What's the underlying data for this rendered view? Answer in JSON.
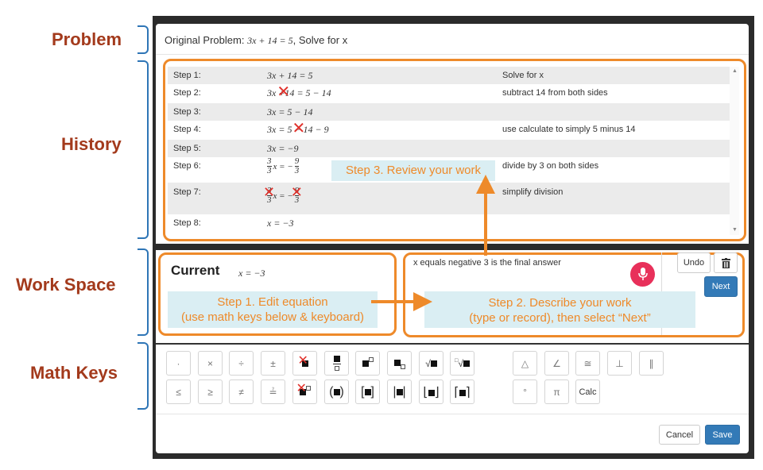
{
  "labels": {
    "problem": "Problem",
    "history": "History",
    "work_space": "Work Space",
    "math_keys": "Math Keys"
  },
  "original_problem": {
    "prefix": "Original Problem:",
    "equation": "3x + 14 = 5",
    "suffix": ", Solve for x"
  },
  "history": [
    {
      "step": "Step 1:",
      "eq_a": "3x + 14 = 5",
      "eq_b": "",
      "eq_c": "",
      "desc": "Solve for x"
    },
    {
      "step": "Step 2:",
      "eq_a": "3x",
      "eq_b": "+14",
      "eq_c": "= 5 − 14",
      "desc": "subtract 14 from both sides"
    },
    {
      "step": "Step 3:",
      "eq_a": "3x = 5 − 14",
      "eq_b": "",
      "eq_c": "",
      "desc": ""
    },
    {
      "step": "Step 4:",
      "eq_a": "3x =",
      "eq_b": "5 − 14",
      "eq_c": "− 9",
      "desc": "use calculate to simply 5 minus 14"
    },
    {
      "step": "Step 5:",
      "eq_a": "3x = −9",
      "eq_b": "",
      "eq_c": "",
      "desc": ""
    },
    {
      "step": "Step 6:",
      "eq_a": "x = −",
      "eq_b": "",
      "eq_c": "",
      "desc": "divide by 3 on both sides"
    },
    {
      "step": "Step 7:",
      "eq_a": "x = −",
      "eq_b": "",
      "eq_c": "",
      "desc": "simplify division"
    },
    {
      "step": "Step 8:",
      "eq_a": "x = −3",
      "eq_b": "",
      "eq_c": "",
      "desc": ""
    }
  ],
  "fractions": {
    "three": "3",
    "nine": "9"
  },
  "current": {
    "label": "Current",
    "equation": "x = −3"
  },
  "description_text": "x equals negative 3 is the final answer",
  "buttons": {
    "undo": "Undo",
    "next": "Next",
    "cancel": "Cancel",
    "save": "Save",
    "calc": "Calc"
  },
  "callouts": {
    "step1_line1": "Step 1. Edit equation",
    "step1_line2": "(use math keys below & keyboard)",
    "step2_line1": "Step 2. Describe your work",
    "step2_line2": "(type or record), then select “Next”",
    "step3": "Step 3. Review your work"
  },
  "keys_row1": [
    "·",
    "×",
    "÷",
    "±"
  ],
  "keys_row2": [
    "≤",
    "≥",
    "≠",
    "≟"
  ],
  "geo_row1": [
    "△",
    "∠",
    "≅",
    "⊥",
    "∥"
  ],
  "geo_row2": [
    "°",
    "π"
  ],
  "colors": {
    "accent_orange": "#ee8a2a",
    "label_red": "#a33a1c",
    "brace_blue": "#2e75b6",
    "primary_blue": "#337ab7",
    "mic_red": "#e8305a",
    "callout_bg": "#daeef3"
  }
}
